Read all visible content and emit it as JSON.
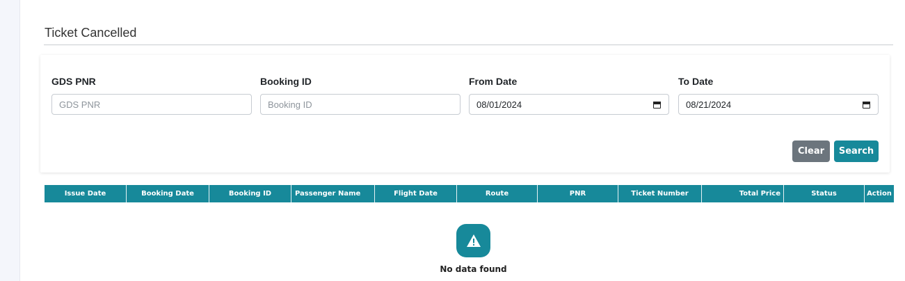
{
  "page": {
    "title": "Ticket Cancelled"
  },
  "filters": {
    "gds_pnr": {
      "label": "GDS PNR",
      "placeholder": "GDS PNR",
      "value": ""
    },
    "booking_id": {
      "label": "Booking ID",
      "placeholder": "Booking ID",
      "value": ""
    },
    "from_date": {
      "label": "From Date",
      "value": "08/01/2024"
    },
    "to_date": {
      "label": "To Date",
      "value": "08/21/2024"
    },
    "clear_label": "Clear",
    "search_label": "Search"
  },
  "table": {
    "columns": [
      "Issue Date",
      "Booking Date",
      "Booking ID",
      "Passenger Name",
      "Flight Date",
      "Route",
      "PNR",
      "Ticket Number",
      "Total Price",
      "Status",
      "Action"
    ],
    "rows": []
  },
  "empty_state": {
    "icon": "warning-icon",
    "text": "No data found"
  },
  "colors": {
    "accent": "#17899a",
    "clear_button": "#6c757d"
  }
}
